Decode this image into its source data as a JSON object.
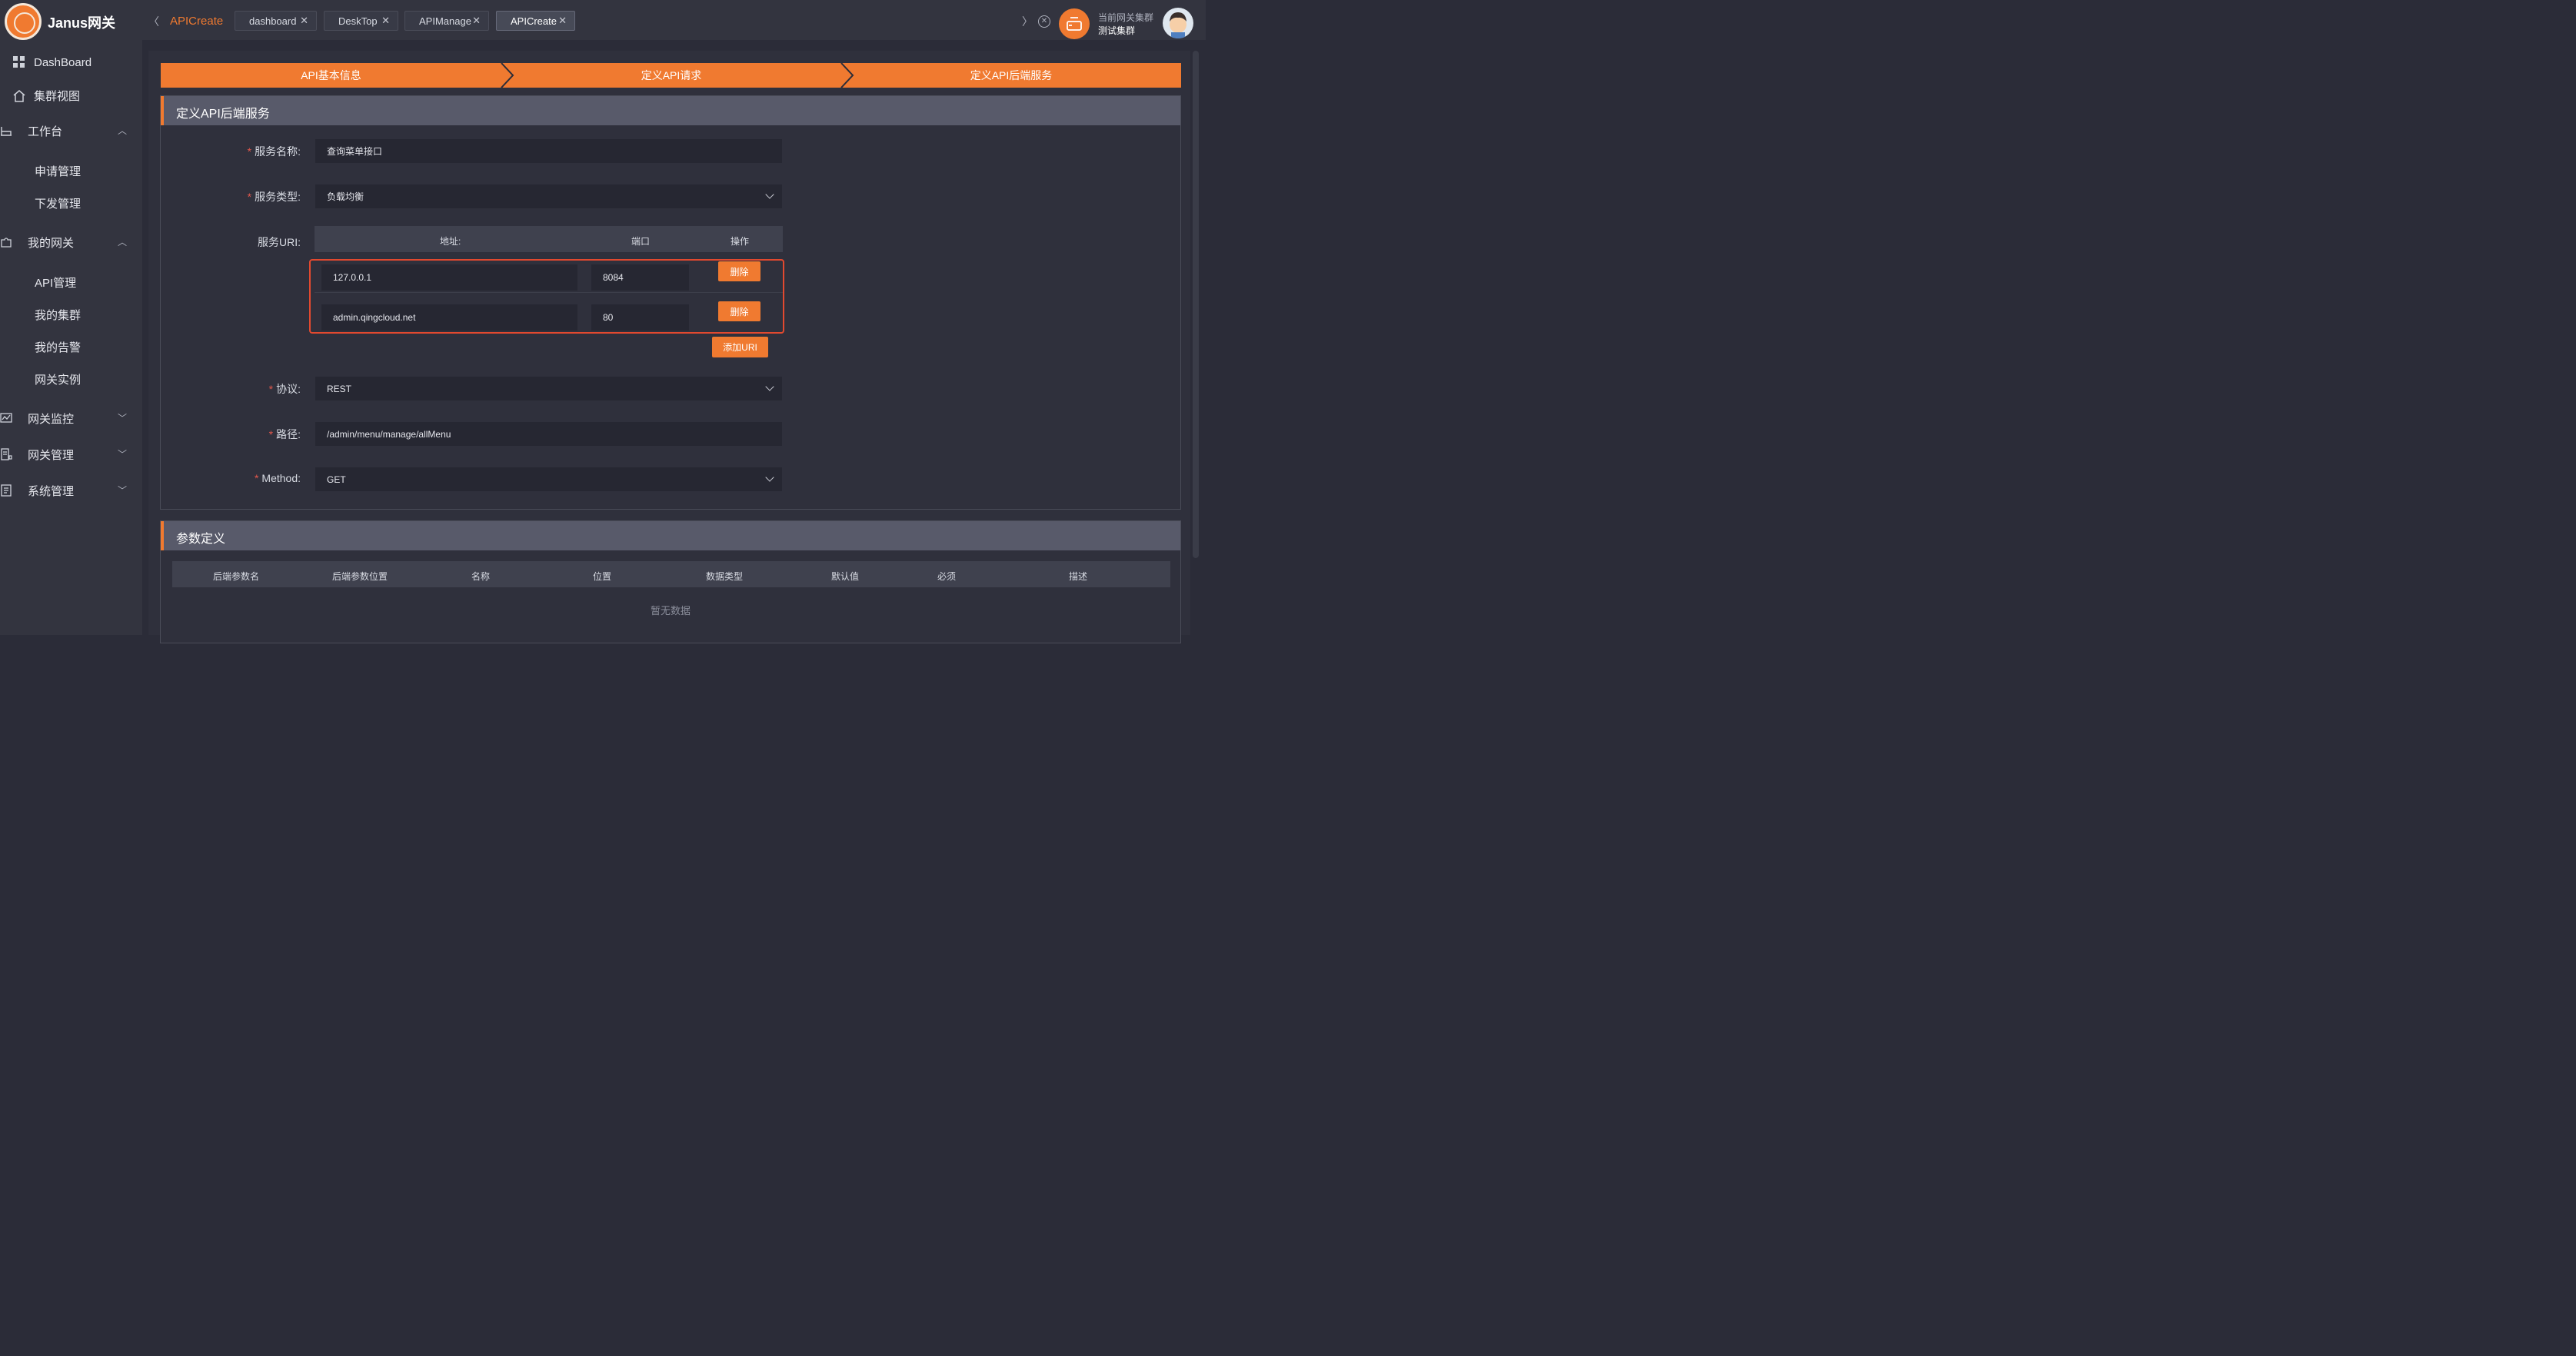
{
  "brand": "Janus网关",
  "sidebar": {
    "top_items": [
      {
        "label": "DashBoard",
        "icon": "grid-icon"
      },
      {
        "label": "集群视图",
        "icon": "home-icon"
      }
    ],
    "groups": [
      {
        "label": "工作台",
        "icon": "workbench-icon",
        "expanded": true,
        "items": [
          "申请管理",
          "下发管理"
        ]
      },
      {
        "label": "我的网关",
        "icon": "puzzle-icon",
        "expanded": true,
        "items": [
          "API管理",
          "我的集群",
          "我的告警",
          "网关实例"
        ]
      },
      {
        "label": "网关监控",
        "icon": "monitor-icon",
        "expanded": false,
        "items": []
      },
      {
        "label": "网关管理",
        "icon": "gateway-manage-icon",
        "expanded": false,
        "items": []
      },
      {
        "label": "系统管理",
        "icon": "system-icon",
        "expanded": false,
        "items": []
      }
    ]
  },
  "topbar": {
    "active_page": "APICreate",
    "tabs": [
      {
        "label": "dashboard",
        "active": false
      },
      {
        "label": "DeskTop",
        "active": false
      },
      {
        "label": "APIManage",
        "active": false
      },
      {
        "label": "APICreate",
        "active": true
      }
    ],
    "tab_close": "✕",
    "cluster_label": "当前网关集群",
    "cluster_name": "测试集群"
  },
  "steps": [
    "API基本信息",
    "定义API请求",
    "定义API后端服务"
  ],
  "backend": {
    "title": "定义API后端服务",
    "service_name_label": "服务名称:",
    "service_name": "查询菜单接口",
    "service_type_label": "服务类型:",
    "service_type": "负载均衡",
    "uri_label": "服务URI:",
    "uri_columns": [
      "地址:",
      "端口",
      "操作"
    ],
    "uri_rows": [
      {
        "address": "127.0.0.1",
        "port": "8084",
        "action": "删除"
      },
      {
        "address": "admin.qingcloud.net",
        "port": "80",
        "action": "删除"
      }
    ],
    "add_uri": "添加URI",
    "protocol_label": "协议:",
    "protocol": "REST",
    "path_label": "路径:",
    "path": "/admin/menu/manage/allMenu",
    "method_label": "Method:",
    "method": "GET"
  },
  "params": {
    "title": "参数定义",
    "columns": [
      "后端参数名",
      "后端参数位置",
      "名称",
      "位置",
      "数据类型",
      "默认值",
      "必须",
      "描述"
    ],
    "empty": "暂无数据"
  },
  "colors": {
    "accent": "#f07a30",
    "sidebar_bg": "#33343f",
    "content_bg": "#2b2c38",
    "highlight": "#e2492f"
  }
}
